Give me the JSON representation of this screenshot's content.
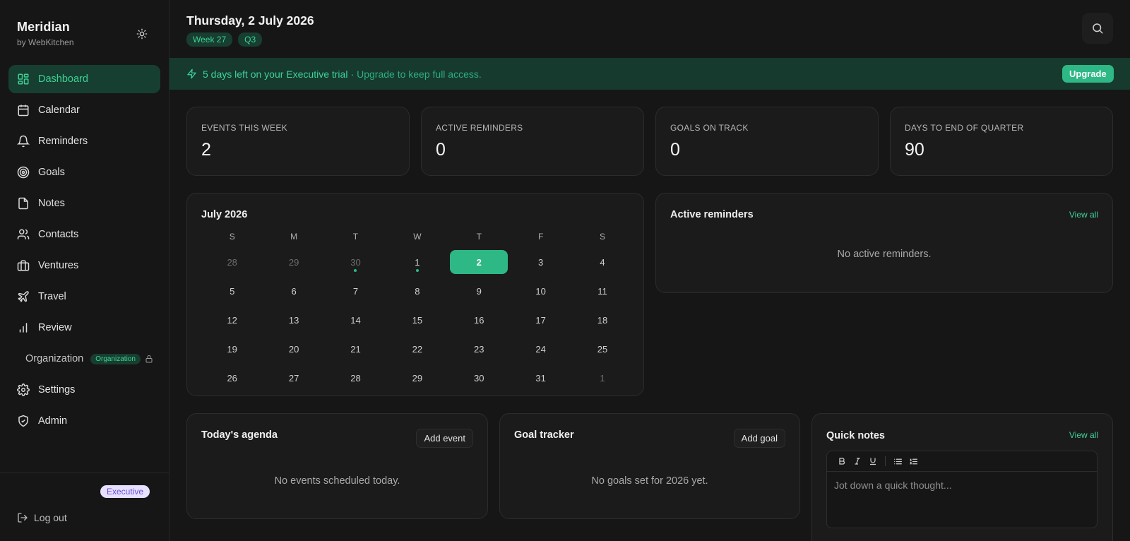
{
  "brand": {
    "name": "Meridian",
    "sub": "by WebKitchen"
  },
  "nav": {
    "items": [
      {
        "key": "dashboard",
        "label": "Dashboard",
        "icon": "dashboard-icon",
        "active": true
      },
      {
        "key": "calendar",
        "label": "Calendar",
        "icon": "calendar-icon"
      },
      {
        "key": "reminders",
        "label": "Reminders",
        "icon": "bell-icon"
      },
      {
        "key": "goals",
        "label": "Goals",
        "icon": "target-icon"
      },
      {
        "key": "notes",
        "label": "Notes",
        "icon": "note-icon"
      },
      {
        "key": "contacts",
        "label": "Contacts",
        "icon": "users-icon"
      },
      {
        "key": "ventures",
        "label": "Ventures",
        "icon": "briefcase-icon"
      },
      {
        "key": "travel",
        "label": "Travel",
        "icon": "plane-icon"
      },
      {
        "key": "review",
        "label": "Review",
        "icon": "bar-chart-icon"
      }
    ],
    "organization": {
      "label": "Organization",
      "badge": "Organization"
    },
    "bottom_items": [
      {
        "key": "settings",
        "label": "Settings",
        "icon": "gear-icon"
      },
      {
        "key": "admin",
        "label": "Admin",
        "icon": "shield-icon"
      }
    ]
  },
  "footer": {
    "plan": "Executive",
    "logout": "Log out"
  },
  "header": {
    "date": "Thursday, 2 July 2026",
    "chips": [
      "Week 27",
      "Q3"
    ]
  },
  "banner": {
    "main": "5 days left on your Executive trial",
    "separator": "·",
    "sub": "Upgrade to keep full access.",
    "button": "Upgrade"
  },
  "stats": [
    {
      "label": "EVENTS THIS WEEK",
      "value": "2"
    },
    {
      "label": "ACTIVE REMINDERS",
      "value": "0"
    },
    {
      "label": "GOALS ON TRACK",
      "value": "0"
    },
    {
      "label": "DAYS TO END OF QUARTER",
      "value": "90"
    }
  ],
  "calendar": {
    "title": "July 2026",
    "weekdays": [
      "S",
      "M",
      "T",
      "W",
      "T",
      "F",
      "S"
    ],
    "weeks": [
      [
        {
          "d": "28",
          "muted": true
        },
        {
          "d": "29",
          "muted": true
        },
        {
          "d": "30",
          "muted": true,
          "dot": true
        },
        {
          "d": "1",
          "dot": true
        },
        {
          "d": "2",
          "today": true
        },
        {
          "d": "3"
        },
        {
          "d": "4"
        }
      ],
      [
        {
          "d": "5"
        },
        {
          "d": "6"
        },
        {
          "d": "7"
        },
        {
          "d": "8"
        },
        {
          "d": "9"
        },
        {
          "d": "10"
        },
        {
          "d": "11"
        }
      ],
      [
        {
          "d": "12"
        },
        {
          "d": "13"
        },
        {
          "d": "14"
        },
        {
          "d": "15"
        },
        {
          "d": "16"
        },
        {
          "d": "17"
        },
        {
          "d": "18"
        }
      ],
      [
        {
          "d": "19"
        },
        {
          "d": "20"
        },
        {
          "d": "21"
        },
        {
          "d": "22"
        },
        {
          "d": "23"
        },
        {
          "d": "24"
        },
        {
          "d": "25"
        }
      ],
      [
        {
          "d": "26"
        },
        {
          "d": "27"
        },
        {
          "d": "28"
        },
        {
          "d": "29"
        },
        {
          "d": "30"
        },
        {
          "d": "31"
        },
        {
          "d": "1",
          "muted": true
        }
      ]
    ]
  },
  "reminders": {
    "title": "Active reminders",
    "view_all": "View all",
    "empty": "No active reminders."
  },
  "agenda": {
    "title": "Today's agenda",
    "button": "Add event",
    "empty": "No events scheduled today."
  },
  "goals": {
    "title": "Goal tracker",
    "button": "Add goal",
    "empty": "No goals set for 2026 yet."
  },
  "quick_notes": {
    "title": "Quick notes",
    "view_all": "View all",
    "placeholder": "Jot down a quick thought...",
    "toolbar": [
      "bold-icon",
      "italic-icon",
      "underline-icon",
      "bullet-list-icon",
      "numbered-list-icon"
    ]
  },
  "colors": {
    "accent": "#2db886",
    "accent_text": "#3fd29a",
    "background": "#161616",
    "card": "#1b1b1b"
  }
}
